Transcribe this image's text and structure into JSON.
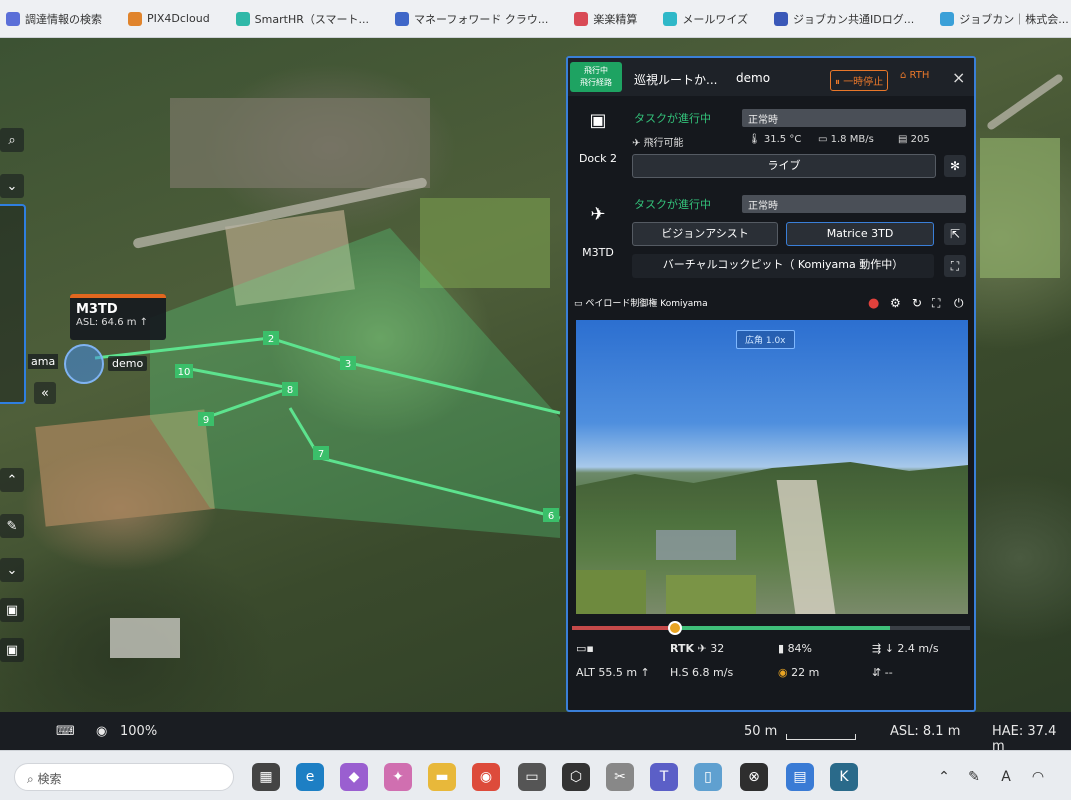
{
  "bookmarks": [
    {
      "label": "調達情報の検索",
      "color": "#5b6fd8"
    },
    {
      "label": "PIX4Dcloud",
      "color": "#e0842c"
    },
    {
      "label": "SmartHR（スマート...",
      "color": "#2fb8a8"
    },
    {
      "label": "マネーフォワード クラウ...",
      "color": "#3f67c8"
    },
    {
      "label": "楽楽精算",
      "color": "#d94a55"
    },
    {
      "label": "メールワイズ",
      "color": "#2fb8c8"
    },
    {
      "label": "ジョブカン共通IDログ...",
      "color": "#3a58b8"
    },
    {
      "label": "ジョブカン｜株式会...",
      "color": "#3aa0d8"
    }
  ],
  "map": {
    "drone_label": {
      "name": "M3TD",
      "asl": "ASL: 64.6 m ↑"
    },
    "dock_label": "demo",
    "side_label": "ama",
    "waypoints": [
      "2",
      "3",
      "8",
      "10",
      "9",
      "7",
      "6"
    ]
  },
  "map_status": {
    "zoom": "100%",
    "scale": "50 m",
    "asl": "ASL: 8.1 m",
    "hae": "HAE: 37.4 m"
  },
  "panel": {
    "badge": "飛行中\n飛行経路",
    "title": "巡視ルートか...",
    "project": "demo",
    "pause_label": "一時停止",
    "rth_label": "RTH",
    "close_icon": "×",
    "dock": {
      "name": "Dock 2",
      "status": "タスクが進行中",
      "state": "正常時",
      "flyable": "飛行可能",
      "temp": "31.5 °C",
      "rate": "1.8 MB/s",
      "storage": "205",
      "live_button": "ライブ"
    },
    "drone": {
      "name": "M3TD",
      "status": "タスクが進行中",
      "state": "正常時",
      "vision_button": "ビジョンアシスト",
      "model_button": "Matrice 3TD",
      "cockpit_button": "バーチャルコックピット（  Komiyama 動作中）"
    },
    "video": {
      "header": "ペイロード制御権 Komiyama",
      "zoom_tag": "広角 1.0x"
    },
    "progress": 0.26,
    "telemetry": {
      "rtk": "RTK",
      "rtk_count": "32",
      "battery": "84%",
      "vspeed": "↓ 2.4 m/s",
      "alt": "ALT 55.5 m ↑",
      "hs": "H.S 6.8 m/s",
      "dist": "22 m",
      "misc": "--"
    }
  },
  "taskbar": {
    "search_placeholder": "検索"
  }
}
